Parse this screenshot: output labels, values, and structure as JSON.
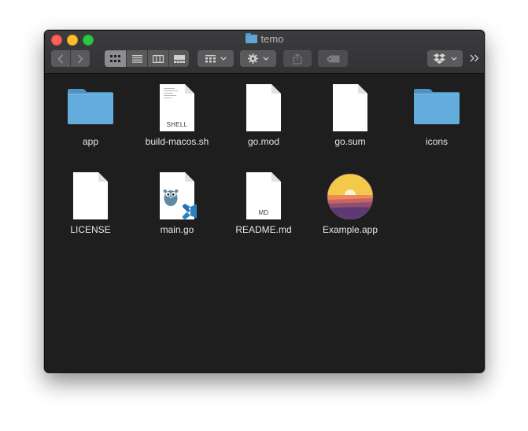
{
  "window": {
    "title": "temo"
  },
  "toolbar": {
    "back_icon": "chevron-left-icon",
    "forward_icon": "chevron-right-icon",
    "view_modes": [
      "icon-view",
      "list-view",
      "column-view",
      "gallery-view"
    ],
    "selected_view": "icon-view",
    "group_icon": "group-by-icon",
    "action_icon": "gear-icon",
    "share_icon": "share-icon",
    "tag_icon": "tag-icon",
    "dropbox_icon": "dropbox-icon",
    "overflow_icon": "chevron-double-right-icon"
  },
  "files": [
    {
      "name": "app",
      "kind": "folder"
    },
    {
      "name": "build-macos.sh",
      "kind": "document",
      "badge": "SHELL"
    },
    {
      "name": "go.mod",
      "kind": "document"
    },
    {
      "name": "go.sum",
      "kind": "document"
    },
    {
      "name": "icons",
      "kind": "folder"
    },
    {
      "name": "LICENSE",
      "kind": "document"
    },
    {
      "name": "main.go",
      "kind": "go-document"
    },
    {
      "name": "README.md",
      "kind": "document",
      "badge": "MD"
    },
    {
      "name": "Example.app",
      "kind": "application"
    }
  ],
  "colors": {
    "folder": "#5ea5d6",
    "close": "#fe5f57",
    "minimize": "#febc2e",
    "maximize": "#28c840",
    "window_bg": "#1e1e1f"
  }
}
